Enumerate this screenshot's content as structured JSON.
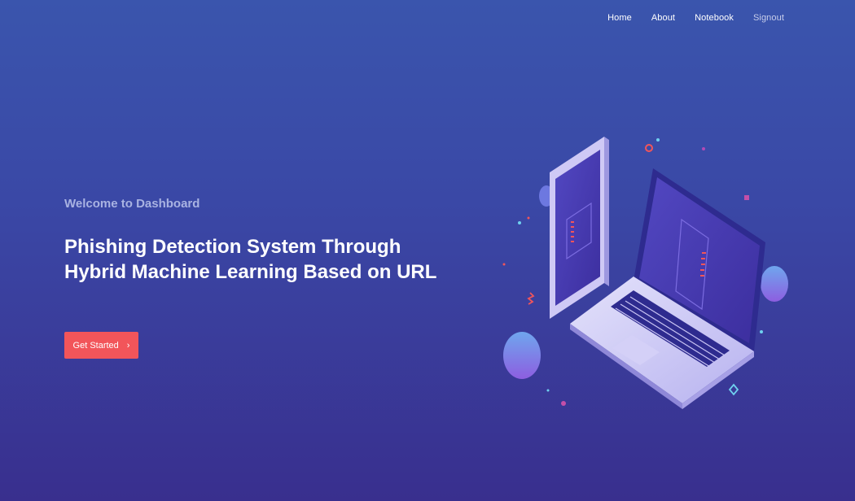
{
  "nav": {
    "items": [
      {
        "label": "Home"
      },
      {
        "label": "About"
      },
      {
        "label": "Notebook"
      },
      {
        "label": "Signout"
      }
    ]
  },
  "hero": {
    "welcome": "Welcome to Dashboard",
    "title_line1": "Phishing Detection System Through",
    "title_line2": "Hybrid Machine Learning Based on URL",
    "cta_label": "Get Started",
    "cta_icon": "chevron-right-icon"
  },
  "colors": {
    "background_top": "#3a55ad",
    "background_bottom": "#392f8e",
    "accent_button": "#f2555a",
    "welcome_text": "#a9b3e2"
  }
}
